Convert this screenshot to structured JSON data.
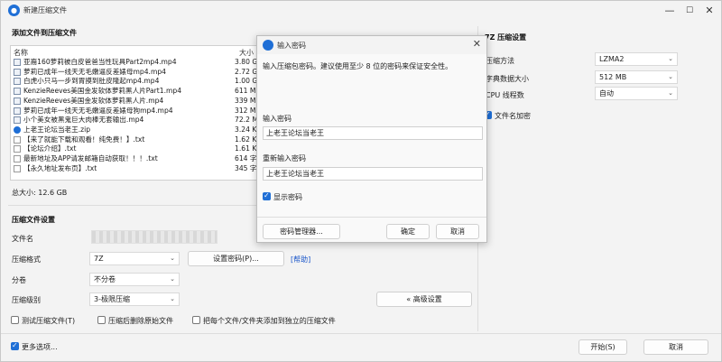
{
  "window": {
    "title": "新建压缩文件",
    "minimize": "—",
    "maximize": "☐",
    "close": "✕"
  },
  "files_section": {
    "title": "添加文件到压缩文件",
    "col_name": "名称",
    "col_size": "大小",
    "rows": [
      {
        "icon": "video-file-icon",
        "name": "亚裔160萝莉被白皮爸爸当性玩具Part2mp4.mp4",
        "size": "3.80 GB"
      },
      {
        "icon": "video-file-icon",
        "name": "萝莉已成年一线天无毛嫩逼反差婊母mp4.mp4",
        "size": "2.72 GB"
      },
      {
        "icon": "video-file-icon",
        "name": "白虎小只马一步到胃摸到肚皮隆起mp4.mp4",
        "size": "1.00 GB"
      },
      {
        "icon": "video-file-icon",
        "name": "KenzieReeves美国金发软体萝莉黑人片Part1.mp4",
        "size": "611 MB"
      },
      {
        "icon": "video-file-icon",
        "name": "KenzieReeves美国金发软体萝莉黑人片.mp4",
        "size": "339 MB"
      },
      {
        "icon": "video-file-icon",
        "name": "萝莉已成年一线天无毛嫩逼反差婊母狗mp4.mp4",
        "size": "312 MB"
      },
      {
        "icon": "video-file-icon",
        "name": "小个美女被黑鬼巨大肉棒无套输出.mp4",
        "size": "72.2 MB"
      },
      {
        "icon": "zip-file-icon",
        "name": "上老王论坛当老王.zip",
        "size": "3.24 KB"
      },
      {
        "icon": "text-file-icon",
        "name": "【来了就能下载和观看！纯免费！】.txt",
        "size": "1.62 KB"
      },
      {
        "icon": "text-file-icon",
        "name": "【论坛介绍】.txt",
        "size": "1.61 KB"
      },
      {
        "icon": "text-file-icon",
        "name": "最新地址及APP请发邮箱自动获取！！！.txt",
        "size": "614 字节"
      },
      {
        "icon": "text-file-icon",
        "name": "【永久地址发布页】.txt",
        "size": "345 字节"
      }
    ],
    "total": "总大小: 12.6 GB"
  },
  "settings": {
    "title": "压缩文件设置",
    "filename_label": "文件名",
    "format_label": "压缩格式",
    "format_value": "7Z",
    "set_password_button": "设置密码(P)...",
    "help_link": "[帮助]",
    "split_label": "分卷",
    "split_value": "不分卷",
    "level_label": "压缩级别",
    "level_value": "3-极限压缩",
    "advanced_button": "« 高级设置",
    "test_checkbox": "测试压缩文件(T)",
    "delete_checkbox": "压缩后删除原始文件",
    "separate_checkbox": "把每个文件/文件夹添加到独立的压缩文件",
    "more_options_checkbox": "更多选项..."
  },
  "z7": {
    "title": "7Z 压缩设置",
    "method_label": "压缩方法",
    "method_value": "LZMA2",
    "dict_label": "字典数据大小",
    "dict_value": "512 MB",
    "threads_label": "CPU 线程数",
    "threads_value": "自动",
    "encrypt_label": "文件名加密"
  },
  "footer": {
    "start_button": "开始(S)",
    "cancel_button": "取消"
  },
  "password_dialog": {
    "title": "输入密码",
    "close": "✕",
    "hint": "输入压缩包密码。建议使用至少 8 位的密码来保证安全性。",
    "pwd_label": "输入密码",
    "pwd_value": "上老王论坛当老王",
    "confirm_label": "重新输入密码",
    "confirm_value": "上老王论坛当老王",
    "show_password": "显示密码",
    "manager_button": "密码管理器...",
    "ok_button": "确定",
    "cancel_button": "取消"
  },
  "colors": {
    "accent": "#1f6fd6",
    "link": "#1a56c9"
  }
}
